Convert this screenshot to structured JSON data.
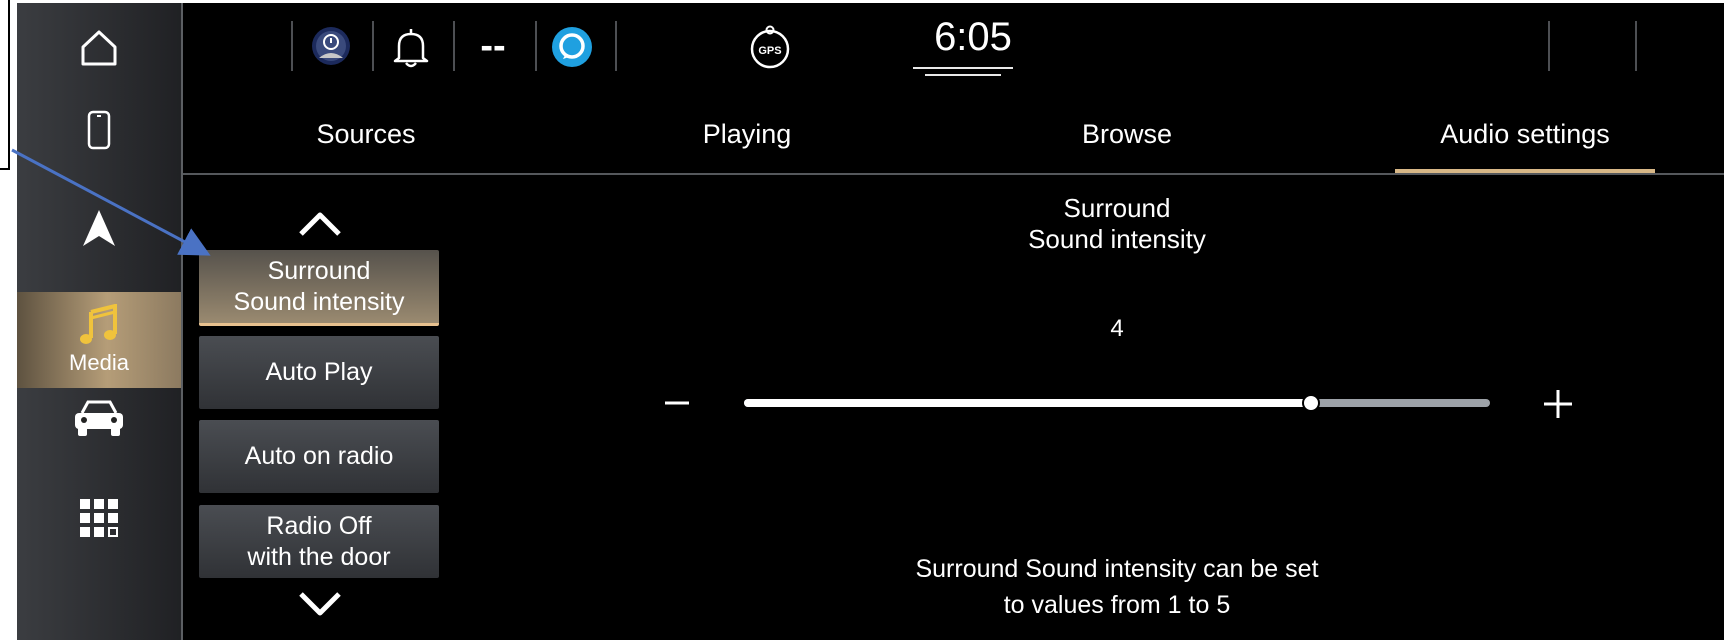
{
  "sidebar": {
    "items": [
      {
        "name": "home",
        "icon": "home-icon"
      },
      {
        "name": "phone",
        "icon": "phone-icon"
      },
      {
        "name": "navigation",
        "icon": "navigation-arrow-icon"
      },
      {
        "name": "media",
        "icon": "music-note-icon",
        "label": "Media",
        "active": true
      },
      {
        "name": "vehicle",
        "icon": "car-icon"
      },
      {
        "name": "apps",
        "icon": "app-grid-icon"
      }
    ]
  },
  "status": {
    "driver_icon": "driver-profile-icon",
    "notification_icon": "bell-icon",
    "dash_text": "--",
    "assistant_icon": "alexa-icon",
    "gps_icon": "gps-icon",
    "gps_text": "GPS",
    "time": "6:05"
  },
  "tabs": [
    {
      "label": "Sources"
    },
    {
      "label": "Playing"
    },
    {
      "label": "Browse"
    },
    {
      "label": "Audio settings",
      "active": true
    }
  ],
  "settings_list": {
    "items": [
      {
        "line1": "Surround",
        "line2": "Sound intensity",
        "selected": true
      },
      {
        "line1": "Auto Play"
      },
      {
        "line1": "Auto on radio"
      },
      {
        "line1": "Radio Off",
        "line2": "with the door"
      }
    ]
  },
  "panel": {
    "title_line1": "Surround",
    "title_line2": "Sound intensity",
    "value": "4",
    "minus": "−",
    "plus": "+",
    "min": 1,
    "max": 5,
    "fill_fraction": 0.76,
    "help_line1": "Surround Sound intensity can be set",
    "help_line2": "to values from 1 to 5"
  },
  "colors": {
    "accent": "#d8b887",
    "pointer_arrow": "#4a72c4",
    "background": "#000000"
  }
}
